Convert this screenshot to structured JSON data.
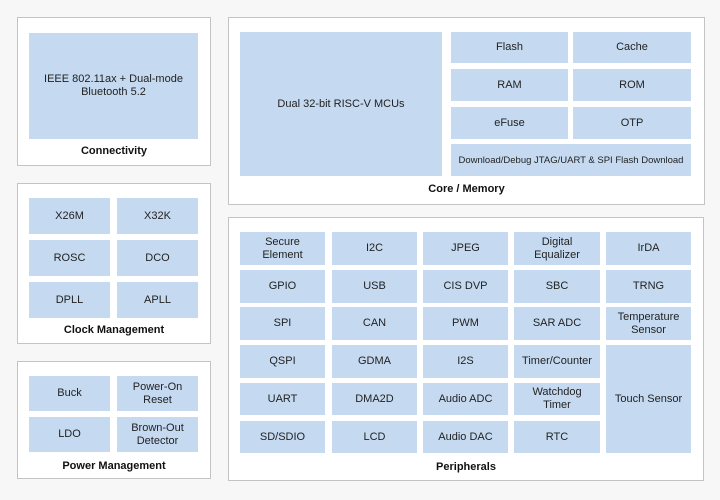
{
  "colors": {
    "background": "#f7f7f7",
    "panel": "#ffffff",
    "panel_border": "#c4c4c4",
    "block": "#c5daf1",
    "text": "#222222"
  },
  "connectivity": {
    "title": "Connectivity",
    "blocks": [
      "IEEE 802.11ax + Dual-mode\nBluetooth 5.2"
    ]
  },
  "core_memory": {
    "title": "Core / Memory",
    "blocks": [
      "Dual 32-bit RISC-V MCUs",
      "Flash",
      "Cache",
      "RAM",
      "ROM",
      "eFuse",
      "OTP",
      "Download/Debug JTAG/UART & SPI Flash Download"
    ]
  },
  "clock_management": {
    "title": "Clock Management",
    "blocks": [
      "X26M",
      "X32K",
      "ROSC",
      "DCO",
      "DPLL",
      "APLL"
    ]
  },
  "power_management": {
    "title": "Power Management",
    "blocks": [
      "Buck",
      "Power-On\nReset",
      "LDO",
      "Brown-Out\nDetector"
    ]
  },
  "peripherals": {
    "title": "Peripherals",
    "blocks": [
      "Secure\nElement",
      "I2C",
      "JPEG",
      "Digital\nEqualizer",
      "IrDA",
      "GPIO",
      "USB",
      "CIS DVP",
      "SBC",
      "TRNG",
      "SPI",
      "CAN",
      "PWM",
      "SAR ADC",
      "Temperature\nSensor",
      "QSPI",
      "GDMA",
      "I2S",
      "Timer/Counter",
      "Touch Sensor",
      "UART",
      "DMA2D",
      "Audio ADC",
      "Watchdog\nTimer",
      "SD/SDIO",
      "LCD",
      "Audio DAC",
      "RTC"
    ]
  }
}
